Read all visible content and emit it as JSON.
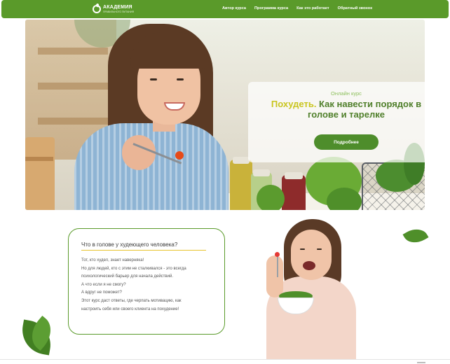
{
  "nav": {
    "logo_main": "АКАДЕМИЯ",
    "logo_sub": "ПРАВИЛЬНОГО ПИТАНИЯ",
    "items": [
      "Автор курса",
      "Программа курса",
      "Как это работает",
      "Обратный звонок"
    ]
  },
  "hero": {
    "kicker": "Онлайн курс",
    "title_accent": "Похудеть.",
    "title_rest": " Как навести порядок в голове и тарелке",
    "button_label": "Подробнее"
  },
  "info": {
    "title": "Что в голове у худеющего человека?",
    "lines": [
      "Тот, кто худел, знает наверняка!",
      "Но для людей, кто с этим не сталкивался - это всегда",
      "психологический барьер для начала действий.",
      "А что если я не смогу?",
      "А вдруг не поможет?",
      "Этот курс даст ответы, где черпать мотивацию, как",
      "настроить себя или своего клиента на похудение!"
    ]
  },
  "colors": {
    "brand_green": "#5a9a2a",
    "button_green": "#4e8d2b",
    "accent_yellow": "#c9c51f",
    "underline_yellow": "#e8c32e"
  }
}
